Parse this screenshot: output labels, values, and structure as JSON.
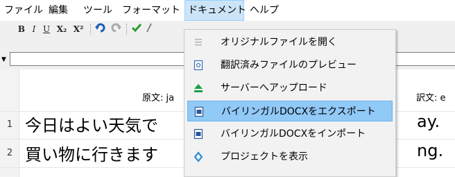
{
  "menubar": {
    "items": [
      "ファイル",
      "編集",
      "ツール",
      "フォーマット",
      "ドキュメント",
      "ヘルプ"
    ]
  },
  "toolbar": {
    "bold": "B",
    "italic": "I",
    "underline": "U",
    "subscript": "X₂",
    "superscript": "X²",
    "undo_icon": "undo-icon",
    "redo_icon": "redo-icon",
    "check_icon": "check-icon"
  },
  "grid": {
    "source_header": "原文: ja",
    "target_header": "訳文: e",
    "rows": [
      {
        "num": "1",
        "source": "今日はよい天気で",
        "target": "ay."
      },
      {
        "num": "2",
        "source": "買い物に行きます",
        "target": "ng."
      }
    ]
  },
  "dropdown": {
    "items": [
      {
        "icon": "document-icon",
        "label": "オリジナルファイルを開く"
      },
      {
        "icon": "preview-icon",
        "label": "翻訳済みファイルのプレビュー"
      },
      {
        "icon": "upload-icon",
        "label": "サーバーへアップロード"
      },
      {
        "icon": "docx-export-icon",
        "label": "バイリンガルDOCXをエクスポート"
      },
      {
        "icon": "docx-import-icon",
        "label": "バイリンガルDOCXをインポート"
      },
      {
        "icon": "project-icon",
        "label": "プロジェクトを表示"
      }
    ]
  },
  "colors": {
    "menu_active_bg": "#cce4f7",
    "highlight_bg": "#91c9f7",
    "upload_icon": "#1e9e4a",
    "project_icon": "#2d8fd6"
  }
}
